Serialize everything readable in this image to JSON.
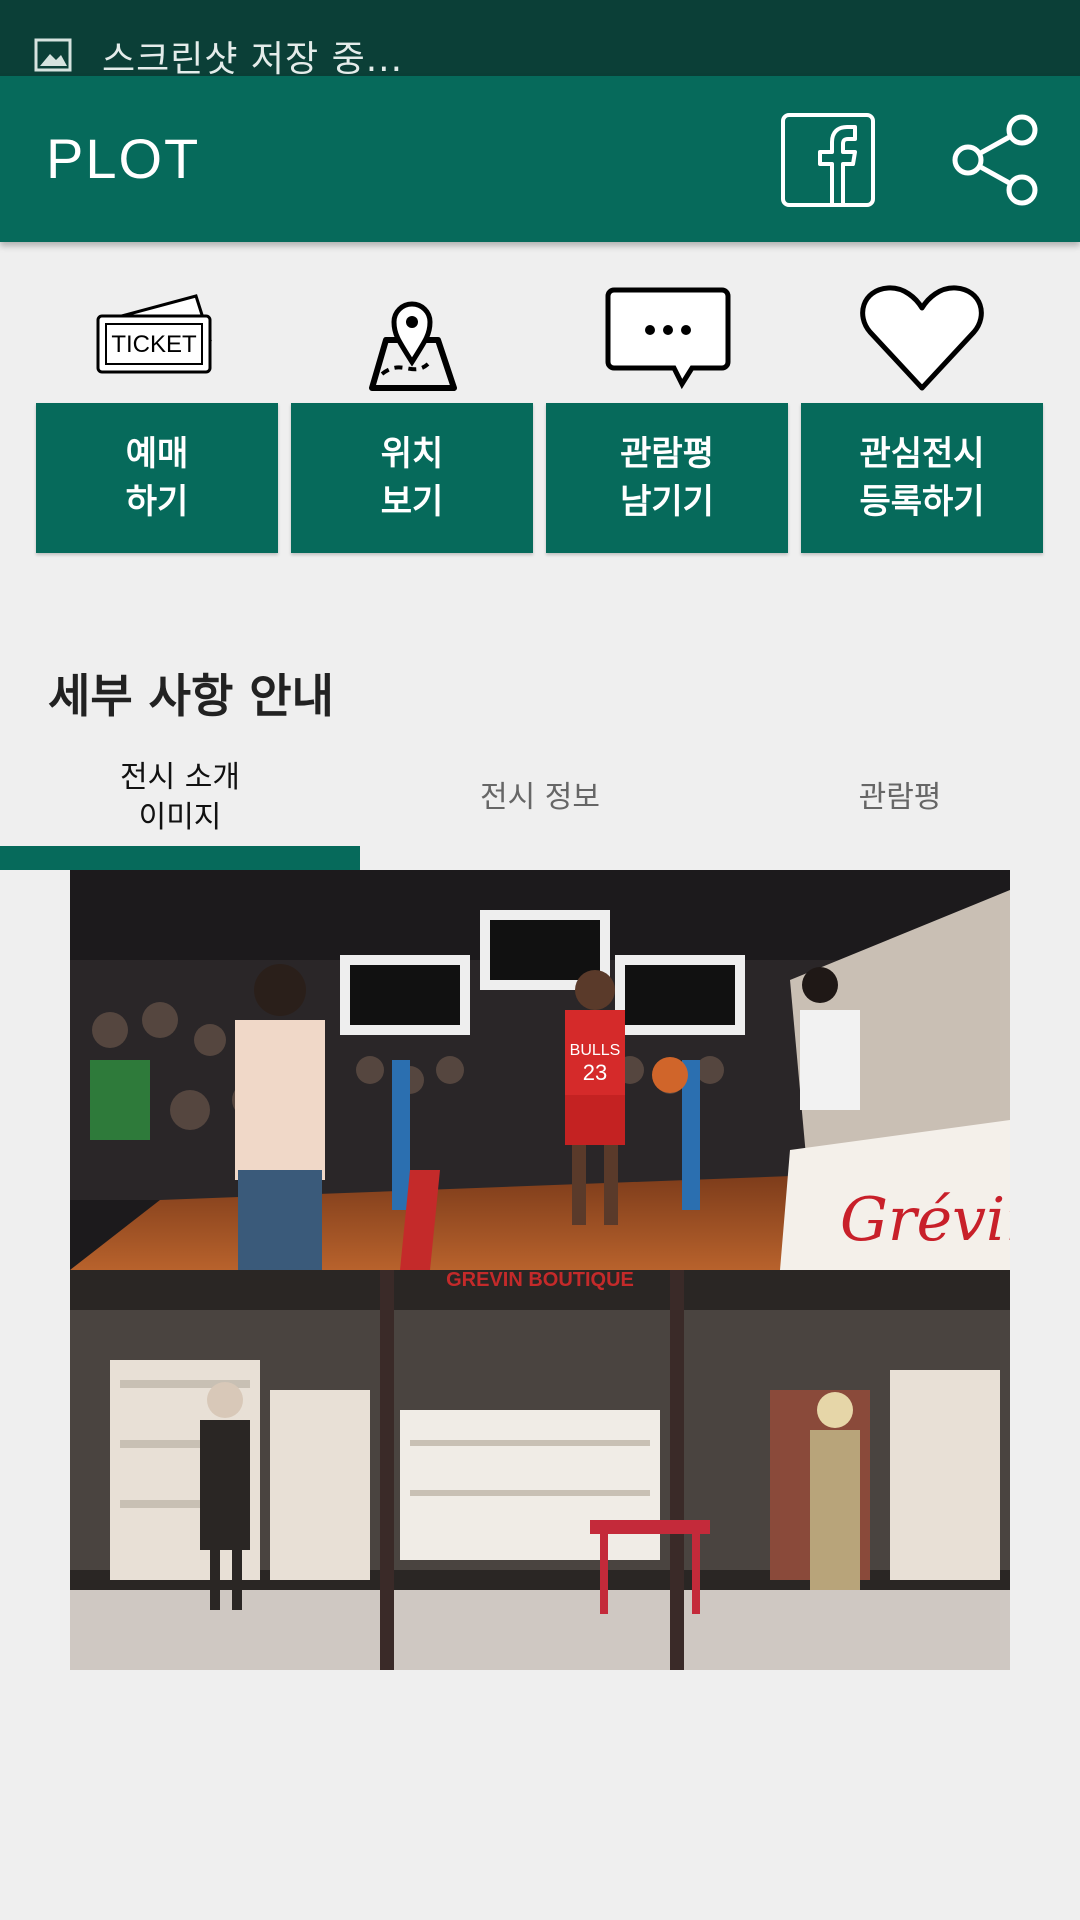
{
  "notification": {
    "text": "스크린샷 저장 중..."
  },
  "appbar": {
    "title": "PLOT"
  },
  "actions": [
    {
      "icon": "ticket-icon",
      "icon_text": "TICKET",
      "label": "예매\n하기"
    },
    {
      "icon": "map-pin-icon",
      "label": "위치\n보기"
    },
    {
      "icon": "chat-bubble-icon",
      "label": "관람평\n남기기"
    },
    {
      "icon": "heart-icon",
      "label": "관심전시\n등록하기"
    }
  ],
  "section": {
    "title": "세부 사항 안내"
  },
  "tabs": [
    {
      "label": "전시 소개\n이미지",
      "active": true
    },
    {
      "label": "전시 정보",
      "active": false
    },
    {
      "label": "관람평",
      "active": false
    }
  ],
  "photos": [
    {
      "description_icon": "basketball-exhibit-photo",
      "sign_text": "Grévin",
      "jersey": "BULLS 23"
    },
    {
      "description_icon": "boutique-photo",
      "sign_text": "GREVIN BOUTIQUE"
    }
  ],
  "colors": {
    "primary": "#066a5b",
    "status": "#0b3f37",
    "background": "#efefef"
  }
}
